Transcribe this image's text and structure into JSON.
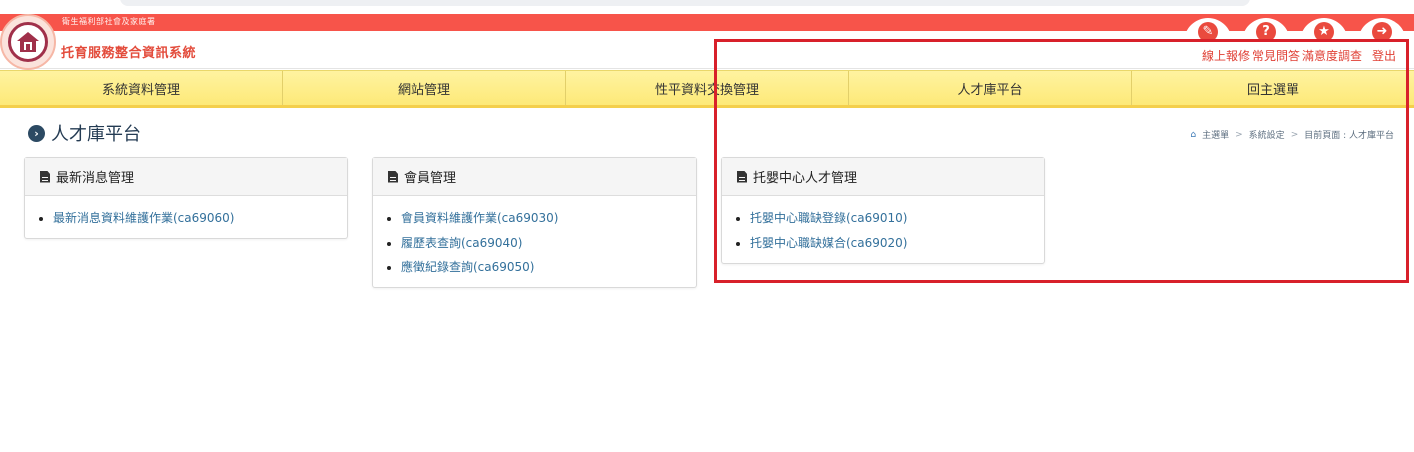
{
  "header": {
    "ministry": "衛生福利部社會及家庭署",
    "system_title": "托育服務整合資訊系統",
    "icon_buttons": [
      {
        "name": "wrench-icon",
        "glyph": "✎"
      },
      {
        "name": "question-icon",
        "glyph": "?"
      },
      {
        "name": "star-icon",
        "glyph": "★"
      },
      {
        "name": "logout-icon",
        "glyph": "➜"
      }
    ],
    "links": {
      "repair": "線上報修",
      "faq": "常見問答",
      "survey": "滿意度調查",
      "logout": "登出"
    }
  },
  "nav": [
    "系統資料管理",
    "網站管理",
    "性平資料交換管理",
    "人才庫平台",
    "回主選單"
  ],
  "page": {
    "title": "人才庫平台",
    "breadcrumb": {
      "home": "主選單",
      "sep": ">",
      "level2": "系統設定",
      "current": "目前頁面 : 人才庫平台"
    }
  },
  "panels": [
    {
      "title": "最新消息管理",
      "items": [
        "最新消息資料維護作業(ca69060)"
      ]
    },
    {
      "title": "會員管理",
      "items": [
        "會員資料維護作業(ca69030)",
        "履歷表查詢(ca69040)",
        "應徵紀錄查詢(ca69050)"
      ]
    },
    {
      "title": "托嬰中心人才管理",
      "items": [
        "托嬰中心職缺登錄(ca69010)",
        "托嬰中心職缺媒合(ca69020)"
      ]
    }
  ],
  "colors": {
    "header_red": "#f7544a",
    "nav_yellow": "#fde978",
    "link_blue": "#33709b",
    "highlight_red": "#d8202a"
  }
}
